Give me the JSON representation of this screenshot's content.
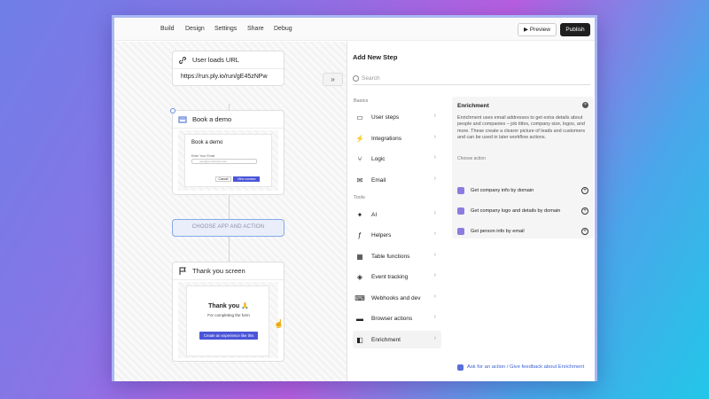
{
  "topbar": {
    "nav": [
      "Build",
      "Design",
      "Settings",
      "Share",
      "Debug"
    ],
    "preview_label": "Preview",
    "publish_label": "Publish"
  },
  "canvas": {
    "url_card": {
      "title": "User loads URL",
      "url": "https://run.ply.io/run/gE45zNPw"
    },
    "demo_card": {
      "title": "Book a demo",
      "form_title": "Book a demo",
      "email_label": "Enter Your Email",
      "email_placeholder": "user@yourdomain.com",
      "cancel_label": "Cancel",
      "view_label": "View courses"
    },
    "choose_label": "CHOOSE APP AND ACTION",
    "thanks_card": {
      "title": "Thank you screen",
      "heading": "Thank you 🙏",
      "subtext": "For completing the form",
      "cta": "Create an experience like this"
    },
    "expand_icon": "»"
  },
  "panel": {
    "title": "Add New Step",
    "search_placeholder": "Search",
    "basics_label": "Basics",
    "tools_label": "Tools",
    "basics": [
      {
        "label": "User steps",
        "icon": "▭"
      },
      {
        "label": "Integrations",
        "icon": "⚡"
      },
      {
        "label": "Logic",
        "icon": "⑂"
      },
      {
        "label": "Email",
        "icon": "✉"
      }
    ],
    "tools": [
      {
        "label": "AI",
        "icon": "✦"
      },
      {
        "label": "Helpers",
        "icon": "ƒ"
      },
      {
        "label": "Table functions",
        "icon": "▦"
      },
      {
        "label": "Event tracking",
        "icon": "◈"
      },
      {
        "label": "Webhooks and dev",
        "icon": "⌨"
      },
      {
        "label": "Browser actions",
        "icon": "▬"
      },
      {
        "label": "Enrichment",
        "icon": "◧"
      }
    ],
    "detail": {
      "title": "Enrichment",
      "description": "Enrichment uses email addresses to get extra details about people and companies – job titles, company size, logos, and more. These create a clearer picture of leads and customers and can be used in later workflow actions.",
      "choose_action": "Choose action",
      "actions": [
        "Get company info by domain",
        "Get company logo and details by domain",
        "Get person info by email"
      ]
    },
    "footer": "Ask for an action / Give feedback about Enrichment"
  }
}
